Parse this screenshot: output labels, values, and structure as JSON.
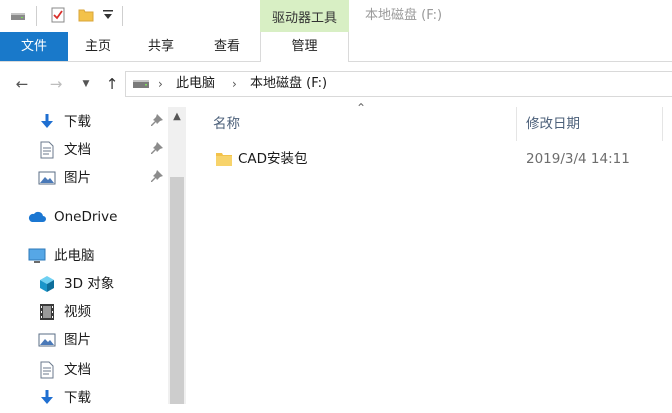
{
  "titlebar": {
    "context_group_label": "驱动器工具",
    "window_title": "本地磁盘 (F:)",
    "quick_access_icons": [
      "drive-icon",
      "properties-check-icon",
      "new-folder-icon",
      "customize-dropdown-icon"
    ]
  },
  "ribbon": {
    "tabs": [
      {
        "id": "file",
        "label": "文件"
      },
      {
        "id": "home",
        "label": "主页"
      },
      {
        "id": "share",
        "label": "共享"
      },
      {
        "id": "view",
        "label": "查看"
      },
      {
        "id": "manage",
        "label": "管理"
      }
    ]
  },
  "address": {
    "breadcrumbs": [
      "此电脑",
      "本地磁盘 (F:)"
    ]
  },
  "nav": {
    "quick_access": [
      {
        "label": "下载",
        "icon": "download-arrow-icon",
        "pinned": true
      },
      {
        "label": "文档",
        "icon": "document-icon",
        "pinned": true
      },
      {
        "label": "图片",
        "icon": "pictures-icon",
        "pinned": true
      }
    ],
    "onedrive": {
      "label": "OneDrive",
      "icon": "cloud-icon"
    },
    "this_pc": {
      "label": "此电脑",
      "icon": "computer-icon"
    },
    "pc_items": [
      {
        "label": "3D 对象",
        "icon": "cube-3d-icon"
      },
      {
        "label": "视频",
        "icon": "video-film-icon"
      },
      {
        "label": "图片",
        "icon": "pictures-icon"
      },
      {
        "label": "文档",
        "icon": "document-icon"
      },
      {
        "label": "下载",
        "icon": "download-arrow-icon"
      }
    ]
  },
  "content": {
    "columns": {
      "name": "名称",
      "modified": "修改日期"
    },
    "files": [
      {
        "name": "CAD安装包",
        "modified": "2019/3/4 14:11",
        "type": "folder"
      }
    ]
  },
  "colors": {
    "file_tab": "#1979ca",
    "context_group": "#d8efc4",
    "column_header_text": "#4c607a",
    "folder": "#f3c24a"
  }
}
